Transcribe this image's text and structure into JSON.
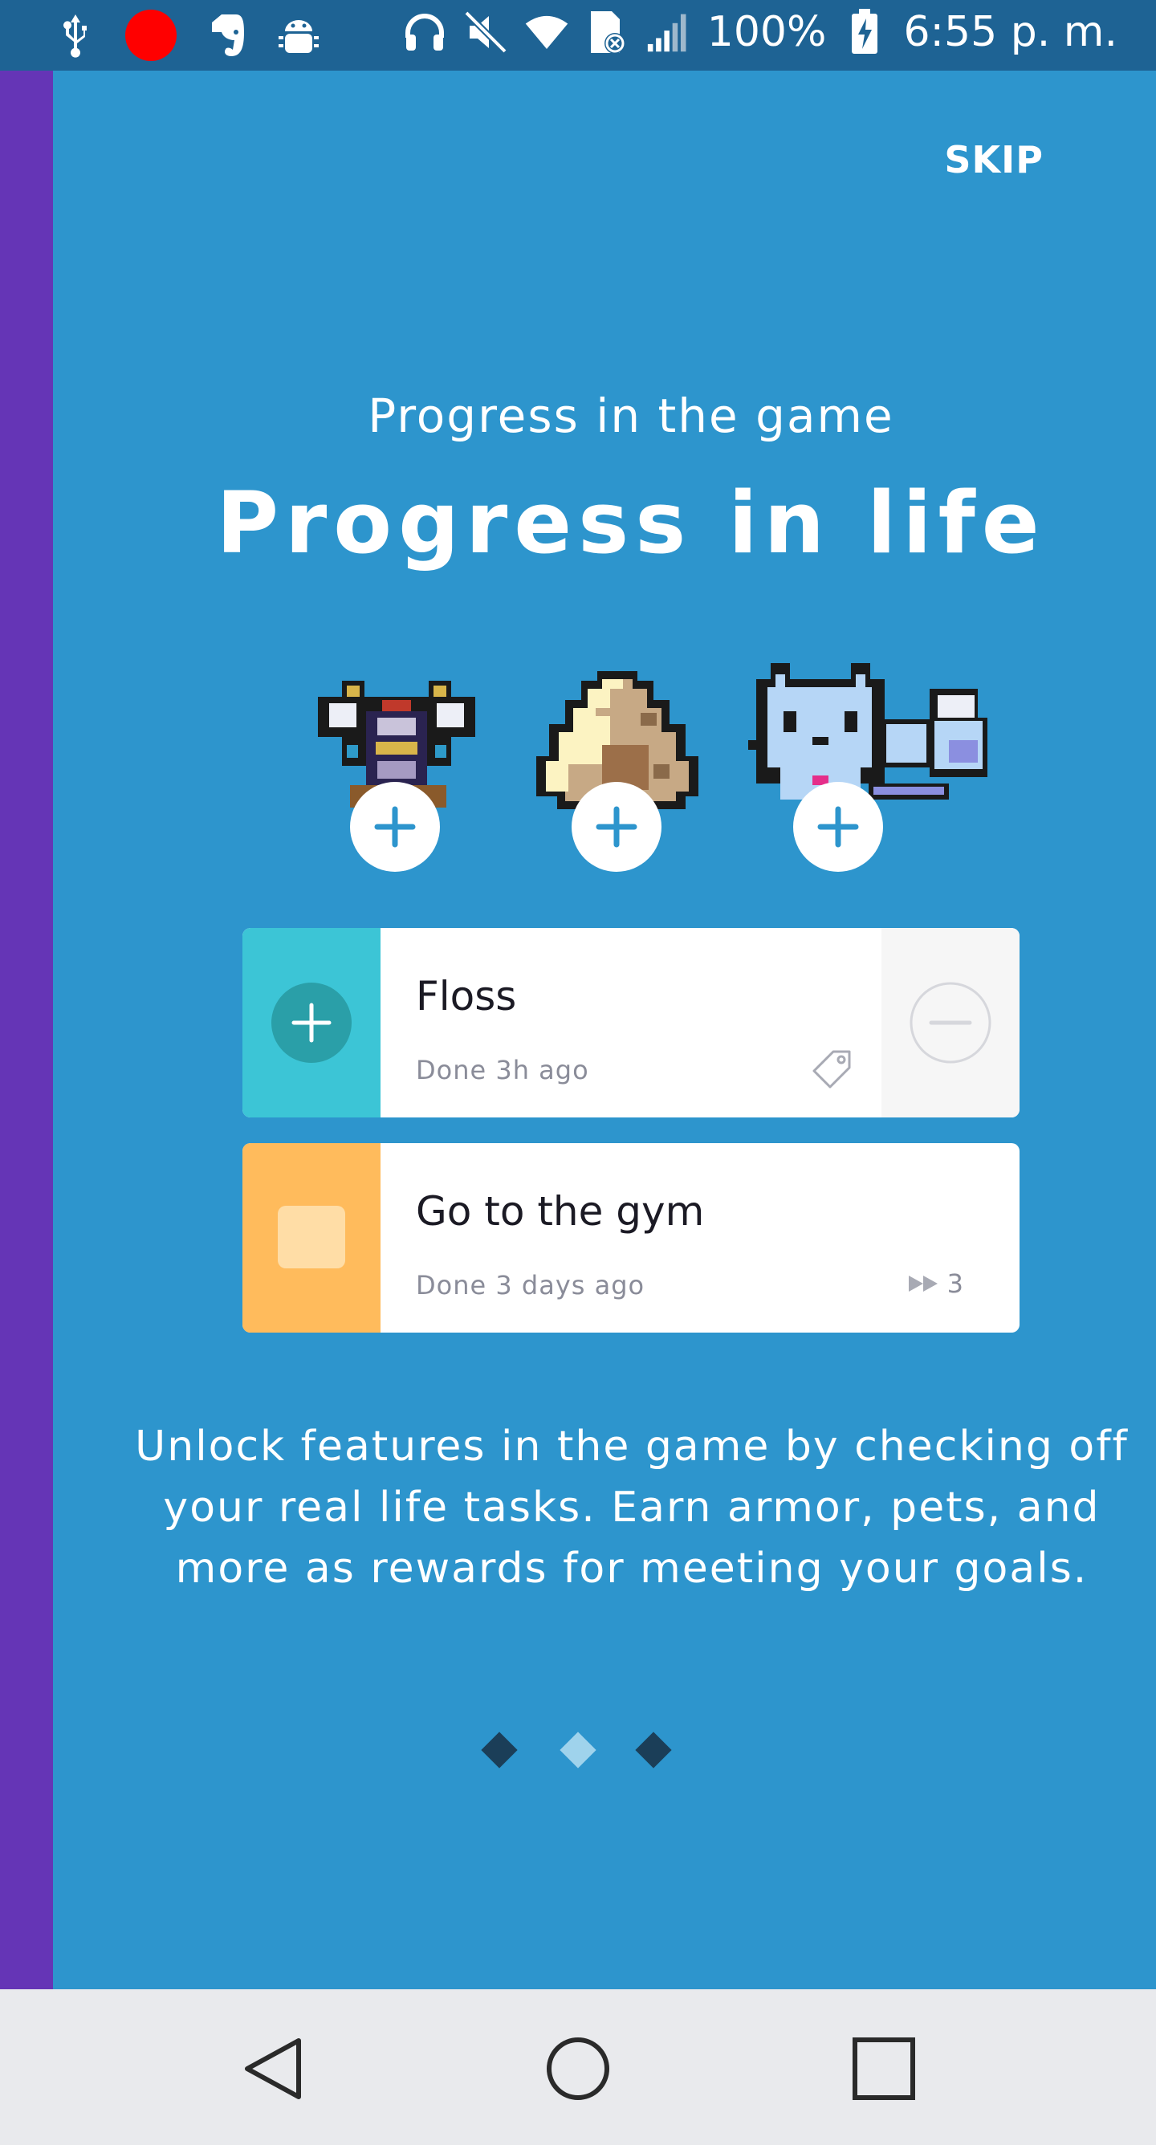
{
  "status_bar": {
    "battery_percent": "100%",
    "time": "6:55 p. m.",
    "icons": [
      "usb-icon",
      "record-icon",
      "evernote-icon",
      "android-debug-icon",
      "headphones-icon",
      "mute-icon",
      "wifi-icon",
      "sim-error-icon",
      "signal-icon",
      "battery-charging-icon"
    ]
  },
  "header": {
    "skip_label": "SKIP"
  },
  "hero": {
    "subtitle": "Progress in the game",
    "title": "Progress in life"
  },
  "rewards": [
    {
      "name": "armor",
      "action": "+"
    },
    {
      "name": "egg",
      "action": "+"
    },
    {
      "name": "pet",
      "action": "+"
    }
  ],
  "tasks": [
    {
      "title": "Floss",
      "status": "Done 3h ago",
      "color": "#3CC5D6",
      "type": "habit"
    },
    {
      "title": "Go to the gym",
      "status": "Done 3 days ago",
      "streak": "3",
      "color": "#FFBB5C",
      "type": "daily"
    }
  ],
  "description": "Unlock features in the game by checking off your real life tasks. Earn armor, pets, and more as rewards for meeting your goals.",
  "pager": {
    "pages": 3,
    "current": 2
  },
  "colors": {
    "background": "#2D95CD",
    "status_bar": "#1E6394",
    "side_strip": "#6535B6",
    "habit_teal": "#3CC5D6",
    "daily_orange": "#FFBB5C"
  },
  "nav": {
    "icons": [
      "back-icon",
      "home-icon",
      "recents-icon"
    ]
  }
}
